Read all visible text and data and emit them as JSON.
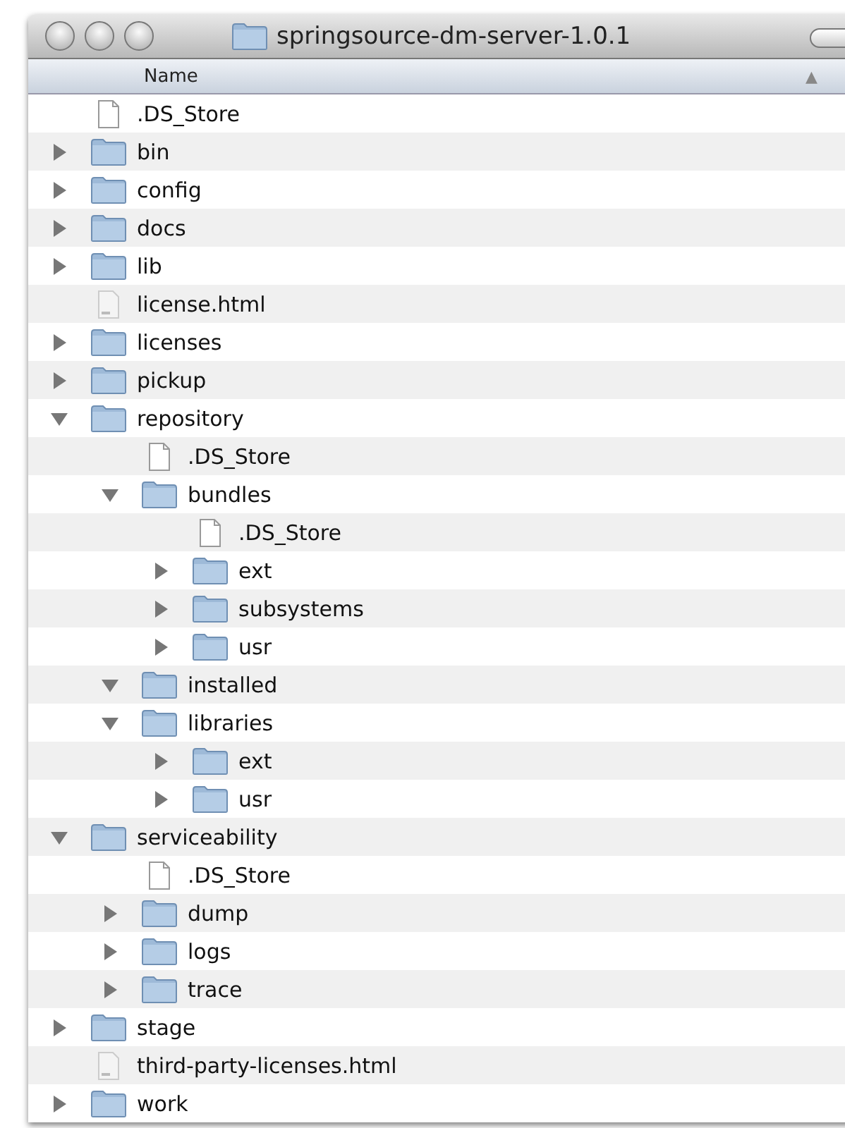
{
  "window": {
    "title": "springsource-dm-server-1.0.1"
  },
  "header": {
    "column": "Name",
    "sort_arrow": "▲"
  },
  "items": [
    {
      "name": ".DS_Store",
      "kind": "file"
    },
    {
      "name": "bin",
      "kind": "folder",
      "expanded": false
    },
    {
      "name": "config",
      "kind": "folder",
      "expanded": false
    },
    {
      "name": "docs",
      "kind": "folder",
      "expanded": false
    },
    {
      "name": "lib",
      "kind": "folder",
      "expanded": false
    },
    {
      "name": "license.html",
      "kind": "html"
    },
    {
      "name": "licenses",
      "kind": "folder",
      "expanded": false
    },
    {
      "name": "pickup",
      "kind": "folder",
      "expanded": false
    },
    {
      "name": "repository",
      "kind": "folder",
      "expanded": true,
      "children": [
        {
          "name": ".DS_Store",
          "kind": "file"
        },
        {
          "name": "bundles",
          "kind": "folder",
          "expanded": true,
          "children": [
            {
              "name": ".DS_Store",
              "kind": "file"
            },
            {
              "name": "ext",
              "kind": "folder",
              "expanded": false
            },
            {
              "name": "subsystems",
              "kind": "folder",
              "expanded": false
            },
            {
              "name": "usr",
              "kind": "folder",
              "expanded": false
            }
          ]
        },
        {
          "name": "installed",
          "kind": "folder",
          "expanded": true
        },
        {
          "name": "libraries",
          "kind": "folder",
          "expanded": true,
          "children": [
            {
              "name": "ext",
              "kind": "folder",
              "expanded": false
            },
            {
              "name": "usr",
              "kind": "folder",
              "expanded": false
            }
          ]
        }
      ]
    },
    {
      "name": "serviceability",
      "kind": "folder",
      "expanded": true,
      "children": [
        {
          "name": ".DS_Store",
          "kind": "file"
        },
        {
          "name": "dump",
          "kind": "folder",
          "expanded": false
        },
        {
          "name": "logs",
          "kind": "folder",
          "expanded": false
        },
        {
          "name": "trace",
          "kind": "folder",
          "expanded": false
        }
      ]
    },
    {
      "name": "stage",
      "kind": "folder",
      "expanded": false
    },
    {
      "name": "third-party-licenses.html",
      "kind": "html"
    },
    {
      "name": "work",
      "kind": "folder",
      "expanded": false
    }
  ]
}
